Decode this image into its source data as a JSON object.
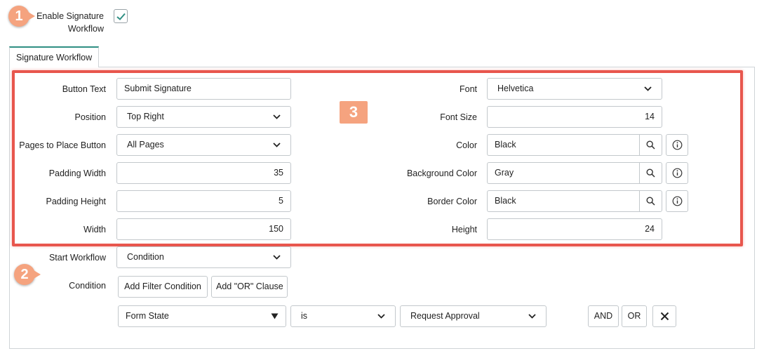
{
  "header": {
    "enable_label_line1": "Enable Signature",
    "enable_label_line2": "Workflow",
    "enable_checked": true
  },
  "callouts": {
    "one": "1",
    "two": "2",
    "three": "3"
  },
  "tab": {
    "label": "Signature Workflow"
  },
  "left_fields": {
    "button_text": {
      "label": "Button Text",
      "value": "Submit Signature"
    },
    "position": {
      "label": "Position",
      "value": "Top Right"
    },
    "pages": {
      "label": "Pages to Place Button",
      "value": "All Pages"
    },
    "padding_width": {
      "label": "Padding Width",
      "value": "35"
    },
    "padding_height": {
      "label": "Padding Height",
      "value": "5"
    },
    "width": {
      "label": "Width",
      "value": "150"
    }
  },
  "right_fields": {
    "font": {
      "label": "Font",
      "value": "Helvetica"
    },
    "font_size": {
      "label": "Font Size",
      "value": "14"
    },
    "color": {
      "label": "Color",
      "value": "Black"
    },
    "background_color": {
      "label": "Background Color",
      "value": "Gray"
    },
    "border_color": {
      "label": "Border Color",
      "value": "Black"
    },
    "height": {
      "label": "Height",
      "value": "24"
    }
  },
  "workflow": {
    "start_label": "Start Workflow",
    "start_value": "Condition",
    "condition_label": "Condition",
    "add_filter_label": "Add Filter Condition",
    "add_or_label": "Add \"OR\" Clause",
    "filter_field": "Form State",
    "filter_operator": "is",
    "filter_value": "Request Approval",
    "and_label": "AND",
    "or_label": "OR"
  },
  "colors": {
    "accent": "#2f8f83",
    "callout": "#f5a37f",
    "highlight": "#e8564d"
  }
}
